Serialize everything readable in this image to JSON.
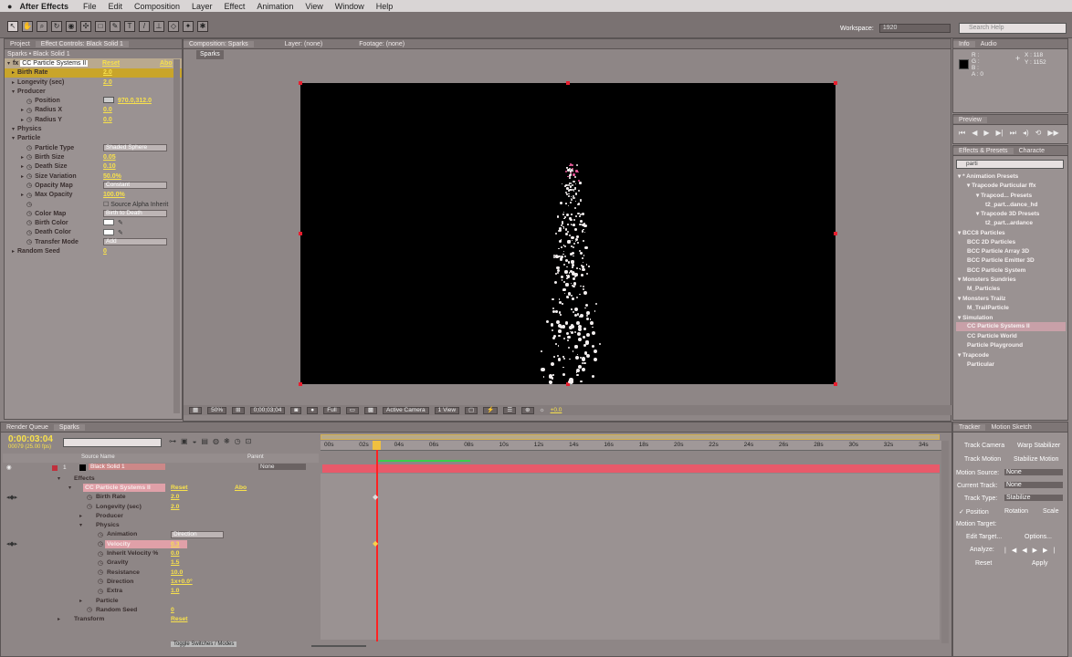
{
  "menubar": {
    "apple": "",
    "app": "After Effects",
    "items": [
      "File",
      "Edit",
      "Composition",
      "Layer",
      "Effect",
      "Animation",
      "View",
      "Window",
      "Help"
    ]
  },
  "toolbar": {
    "workspace_label": "Workspace:",
    "workspace_value": "1920",
    "search_placeholder": "Search Help"
  },
  "project_panel": {
    "tab_project": "Project",
    "tab_effect_controls": "Effect Controls: Black Solid 1",
    "breadcrumb": "Sparks • Black Solid 1",
    "effect_name": "CC Particle Systems II",
    "reset": "Reset",
    "about": "Abo",
    "rows": [
      {
        "label": "Birth Rate",
        "value": "2.0",
        "indent": 1,
        "hl": true
      },
      {
        "label": "Longevity (sec)",
        "value": "2.0",
        "indent": 1
      },
      {
        "label": "Producer",
        "value": "",
        "indent": 1
      },
      {
        "label": "Position",
        "value": "970.0,312.0",
        "indent": 3
      },
      {
        "label": "Radius X",
        "value": "0.0",
        "indent": 3
      },
      {
        "label": "Radius Y",
        "value": "0.0",
        "indent": 3
      },
      {
        "label": "Physics",
        "value": "",
        "indent": 1
      },
      {
        "label": "Particle",
        "value": "",
        "indent": 1
      },
      {
        "label": "Particle Type",
        "value": "",
        "select": "Shaded Sphere",
        "indent": 3
      },
      {
        "label": "Birth Size",
        "value": "0.05",
        "indent": 3
      },
      {
        "label": "Death Size",
        "value": "0.10",
        "indent": 3
      },
      {
        "label": "Size Variation",
        "value": "50.0%",
        "indent": 3
      },
      {
        "label": "Opacity Map",
        "value": "",
        "select": "Constant",
        "indent": 3
      },
      {
        "label": "Max Opacity",
        "value": "100.0%",
        "indent": 3
      },
      {
        "label": "",
        "value": "",
        "check": "Source Alpha Inherit",
        "indent": 3
      },
      {
        "label": "Color Map",
        "value": "",
        "select": "Birth to Death",
        "indent": 3
      },
      {
        "label": "Birth Color",
        "value": "",
        "indent": 3,
        "swatch": true
      },
      {
        "label": "Death Color",
        "value": "",
        "indent": 3,
        "swatch": true
      },
      {
        "label": "Transfer Mode",
        "value": "",
        "select": "Add",
        "indent": 3
      },
      {
        "label": "Random Seed",
        "value": "0",
        "indent": 1
      }
    ]
  },
  "composition": {
    "tab": "Composition: Sparks",
    "layer": "Layer: (none)",
    "footage": "Footage: (none)",
    "subtab": "Sparks",
    "zoom": "50%",
    "timecode": "0;00;03;04",
    "resolution": "Full",
    "camera": "Active Camera",
    "views": "1 View",
    "exposure": "+0.0"
  },
  "info": {
    "tab_info": "Info",
    "tab_audio": "Audio",
    "r": "R :",
    "g": "G :",
    "b": "B :",
    "a": "A : 0",
    "x": "X : 118",
    "y": "Y : 1152"
  },
  "preview": {
    "tab": "Preview"
  },
  "effects_presets": {
    "tab": "Effects & Presets",
    "tab2": "Characte",
    "search": "parti",
    "items": [
      {
        "t": "▾ * Animation Presets",
        "d": 0
      },
      {
        "t": "▾ Trapcode Particular ffx",
        "d": 1
      },
      {
        "t": "▾ Trapcod... Presets",
        "d": 2
      },
      {
        "t": "t2_part...dance_hd",
        "d": 3
      },
      {
        "t": "▾ Trapcode 3D Presets",
        "d": 2
      },
      {
        "t": "t2_part...ardance",
        "d": 3
      },
      {
        "t": "▾ BCC8 Particles",
        "d": 0
      },
      {
        "t": "BCC 2D Particles",
        "d": 1
      },
      {
        "t": "BCC Particle Array 3D",
        "d": 1
      },
      {
        "t": "BCC Particle Emitter 3D",
        "d": 1
      },
      {
        "t": "BCC Particle System",
        "d": 1
      },
      {
        "t": "▾ Monsters Sundries",
        "d": 0
      },
      {
        "t": "M_Particles",
        "d": 1
      },
      {
        "t": "▾ Monsters Trailz",
        "d": 0
      },
      {
        "t": "M_TrailParticle",
        "d": 1
      },
      {
        "t": "▾ Simulation",
        "d": 0
      },
      {
        "t": "CC Particle Systems II",
        "d": 1,
        "sel": true
      },
      {
        "t": "CC Particle World",
        "d": 1
      },
      {
        "t": "Particle Playground",
        "d": 1
      },
      {
        "t": "▾ Trapcode",
        "d": 0
      },
      {
        "t": "Particular",
        "d": 1
      }
    ]
  },
  "tracker": {
    "tab": "Tracker",
    "tab2": "Motion Sketch",
    "track_camera": "Track Camera",
    "warp_stabilizer": "Warp Stabilizer",
    "track_motion": "Track Motion",
    "stabilize_motion": "Stabilize Motion",
    "motion_source_label": "Motion Source:",
    "motion_source": "None",
    "current_track_label": "Current Track:",
    "current_track": "None",
    "track_type_label": "Track Type:",
    "track_type": "Stabilize",
    "position": "Position",
    "rotation": "Rotation",
    "scale": "Scale",
    "motion_target": "Motion Target:",
    "edit_target": "Edit Target...",
    "options": "Options...",
    "analyze": "Analyze:",
    "reset": "Reset",
    "apply": "Apply"
  },
  "timeline": {
    "tab_render": "Render Queue",
    "tab_sparks": "Sparks",
    "timecode": "0:00:03:04",
    "frame": "00079 (25.00 fps)",
    "source_name": "Source Name",
    "parent": "Parent",
    "layer_num": "1",
    "layer_name": "Black Solid 1",
    "parent_val": "None",
    "ruler": [
      "00s",
      "02s",
      "04s",
      "06s",
      "08s",
      "10s",
      "12s",
      "14s",
      "16s",
      "18s",
      "20s",
      "22s",
      "24s",
      "26s",
      "28s",
      "30s",
      "32s",
      "34s"
    ],
    "toggle": "Toggle Switches / Modes",
    "rows": [
      {
        "label": "Effects",
        "value": "",
        "indent": 1
      },
      {
        "label": "CC Particle Systems II",
        "value": "Reset",
        "indent": 2,
        "hl": true,
        "extra": "Abo"
      },
      {
        "label": "Birth Rate",
        "value": "2.0",
        "indent": 3
      },
      {
        "label": "Longevity (sec)",
        "value": "2.0",
        "indent": 3
      },
      {
        "label": "Producer",
        "value": "",
        "indent": 3
      },
      {
        "label": "Physics",
        "value": "",
        "indent": 3
      },
      {
        "label": "Animation",
        "value": "",
        "select": "Direction",
        "indent": 4
      },
      {
        "label": "Velocity",
        "value": "0.3",
        "indent": 4,
        "hl": true
      },
      {
        "label": "Inherit Velocity %",
        "value": "0.0",
        "indent": 4
      },
      {
        "label": "Gravity",
        "value": "1.5",
        "indent": 4
      },
      {
        "label": "Resistance",
        "value": "10.0",
        "indent": 4
      },
      {
        "label": "Direction",
        "value": "1x+0.0°",
        "indent": 4
      },
      {
        "label": "Extra",
        "value": "1.0",
        "indent": 4
      },
      {
        "label": "Particle",
        "value": "",
        "indent": 3
      },
      {
        "label": "Random Seed",
        "value": "0",
        "indent": 3
      },
      {
        "label": "Transform",
        "value": "Reset",
        "indent": 1
      }
    ]
  }
}
